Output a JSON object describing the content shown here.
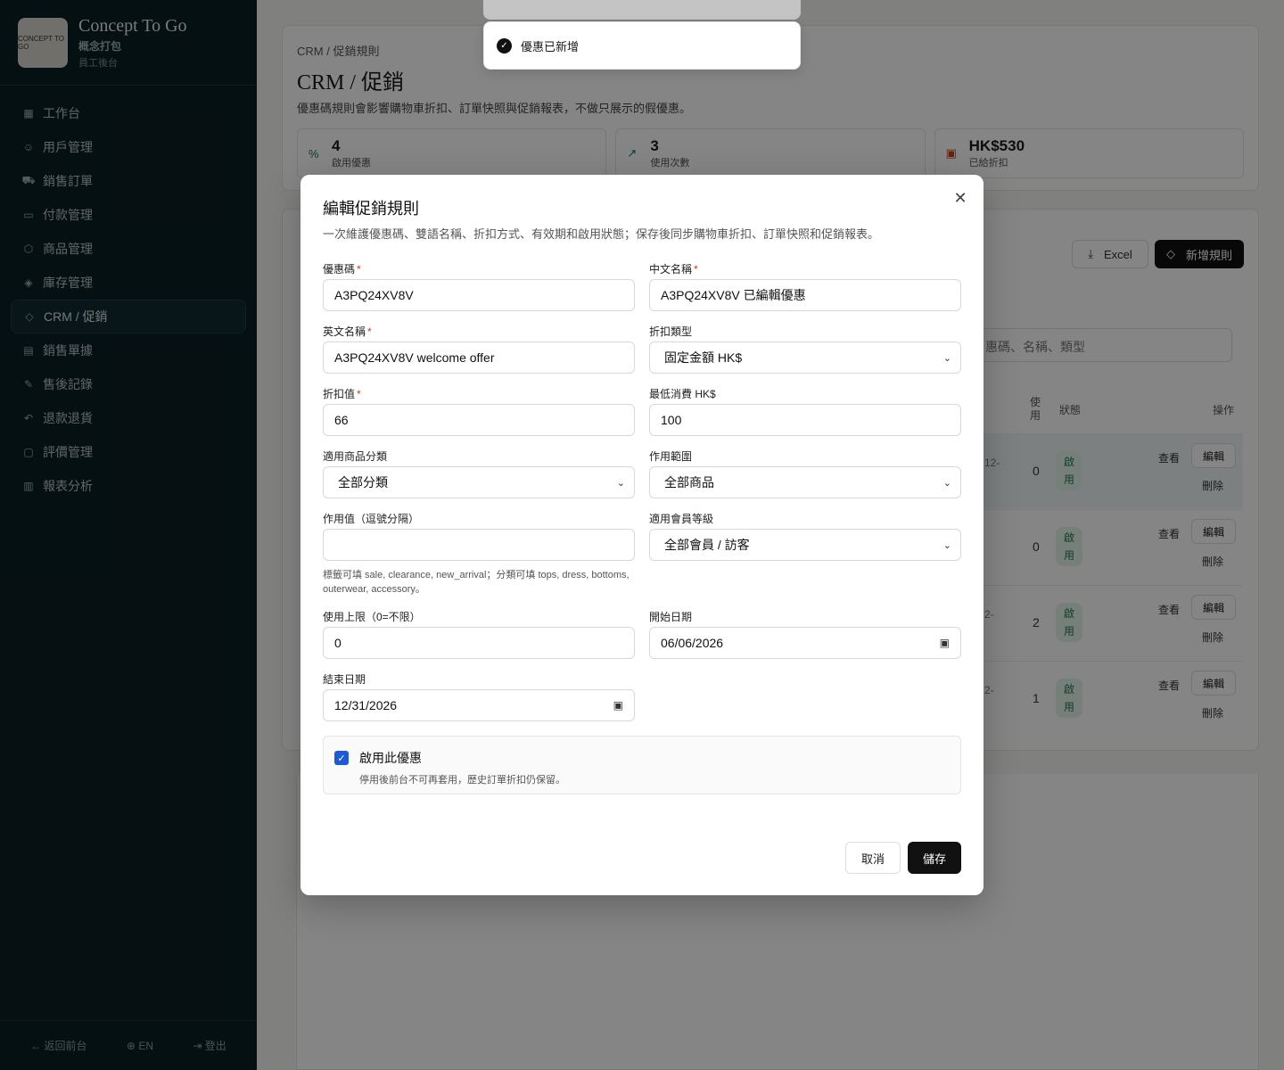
{
  "sidebar": {
    "brand_title": "Concept To Go",
    "brand_sub": "概念打包",
    "brand_sub2": "員工後台",
    "logo_text": "CONCEPT TO GO",
    "items": [
      {
        "label": "工作台",
        "icon": "dashboard-icon"
      },
      {
        "label": "用戶管理",
        "icon": "users-icon"
      },
      {
        "label": "銷售訂單",
        "icon": "cart-icon"
      },
      {
        "label": "付款管理",
        "icon": "card-icon"
      },
      {
        "label": "商品管理",
        "icon": "package-icon"
      },
      {
        "label": "庫存管理",
        "icon": "boxes-icon"
      },
      {
        "label": "CRM / 促銷",
        "icon": "tag-icon"
      },
      {
        "label": "銷售單據",
        "icon": "document-icon"
      },
      {
        "label": "售後記錄",
        "icon": "wrench-icon"
      },
      {
        "label": "退款退貨",
        "icon": "undo-icon"
      },
      {
        "label": "評價管理",
        "icon": "comment-icon"
      },
      {
        "label": "報表分析",
        "icon": "chart-icon"
      }
    ],
    "footer": {
      "back": "← 返回前台",
      "lang": "EN",
      "logout": "登出"
    }
  },
  "page": {
    "crumb": "CRM / 促銷規則",
    "title": "CRM / 促銷",
    "desc": "優惠碼規則會影響購物車折扣、訂單快照與促銷報表，不做只展示的假優惠。",
    "stats": [
      {
        "value": "4",
        "label": "啟用優惠",
        "icon": "percent-icon"
      },
      {
        "value": "3",
        "label": "使用次數",
        "icon": "trending-up-icon"
      },
      {
        "value": "HK$530",
        "label": "已給折扣",
        "icon": "calendar-icon"
      }
    ],
    "excel_label": "Excel",
    "new_rule_label": "新增規則",
    "search_placeholder": "惠碼、名稱、類型",
    "table_headers": {
      "use": "使\n用",
      "status": "狀態",
      "ops": "操作"
    },
    "rows": [
      {
        "count": "0",
        "status": "啟\n用",
        "view": "查看",
        "edit": "編輯",
        "delete": "刪除",
        "frag": "12-"
      },
      {
        "count": "0",
        "status": "啟\n用",
        "view": "查看",
        "edit": "編輯",
        "delete": "刪除",
        "frag": ""
      },
      {
        "count": "2",
        "status": "啟\n用",
        "view": "查看",
        "edit": "編輯",
        "delete": "刪除",
        "frag": "2-"
      },
      {
        "count": "1",
        "status": "啟\n用",
        "view": "查看",
        "edit": "編輯",
        "delete": "刪除",
        "frag": "2-"
      }
    ]
  },
  "toast": {
    "message": "優惠已新增"
  },
  "modal": {
    "title": "編輯促銷規則",
    "desc": "一次維護優惠碼、雙語名稱、折扣方式、有效期和啟用狀態；保存後同步購物車折扣、訂單快照和促銷報表。",
    "fields": {
      "code_label": "優惠碼",
      "code_value": "A3PQ24XV8V",
      "name_zh_label": "中文名稱",
      "name_zh_value": "A3PQ24XV8V 已編輯優惠",
      "name_en_label": "英文名稱",
      "name_en_value": "A3PQ24XV8V welcome offer",
      "discount_type_label": "折扣類型",
      "discount_type_value": "固定金額 HK$",
      "discount_value_label": "折扣值",
      "discount_value_value": "66",
      "min_spend_label": "最低消費 HK$",
      "min_spend_value": "100",
      "category_label": "適用商品分類",
      "category_value": "全部分類",
      "scope_label": "作用範圍",
      "scope_value": "全部商品",
      "scope_values_label": "作用值（逗號分隔）",
      "scope_values_value": "",
      "scope_hint": "標籤可填 sale, clearance, new_arrival；分類可填 tops, dress, bottoms, outerwear, accessory。",
      "member_label": "適用會員等級",
      "member_value": "全部會員 / 訪客",
      "limit_label": "使用上限（0=不限）",
      "limit_value": "0",
      "start_label": "開始日期",
      "start_value": "06/06/2026",
      "end_label": "結束日期",
      "end_value": "12/31/2026"
    },
    "enable_title": "啟用此優惠",
    "enable_sub": "停用後前台不可再套用，歷史訂單折扣仍保留。",
    "cancel_label": "取消",
    "save_label": "儲存"
  }
}
